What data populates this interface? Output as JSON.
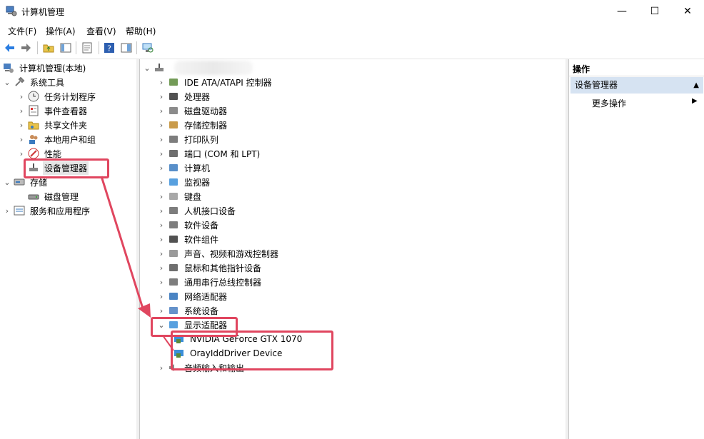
{
  "window": {
    "title": "计算机管理"
  },
  "menu": [
    "文件(F)",
    "操作(A)",
    "查看(V)",
    "帮助(H)"
  ],
  "left_tree": {
    "root": "计算机管理(本地)",
    "system_tools": "系统工具",
    "system_tools_items": [
      "任务计划程序",
      "事件查看器",
      "共享文件夹",
      "本地用户和组",
      "性能",
      "设备管理器"
    ],
    "storage": "存储",
    "storage_items": [
      "磁盘管理"
    ],
    "services": "服务和应用程序"
  },
  "device_tree": {
    "categories": [
      "IDE ATA/ATAPI 控制器",
      "处理器",
      "磁盘驱动器",
      "存储控制器",
      "打印队列",
      "端口 (COM 和 LPT)",
      "计算机",
      "监视器",
      "键盘",
      "人机接口设备",
      "软件设备",
      "软件组件",
      "声音、视频和游戏控制器",
      "鼠标和其他指针设备",
      "通用串行总线控制器",
      "网络适配器",
      "系统设备",
      "显示适配器"
    ],
    "display_children": [
      "NVIDIA GeForce GTX 1070",
      "OrayIddDriver Device"
    ],
    "last_category": "音频输入和输出"
  },
  "actions": {
    "header": "操作",
    "selected": "设备管理器",
    "more": "更多操作"
  },
  "colors": {
    "highlight": "#e0465f",
    "action_selected_bg": "#d6e3f2"
  }
}
